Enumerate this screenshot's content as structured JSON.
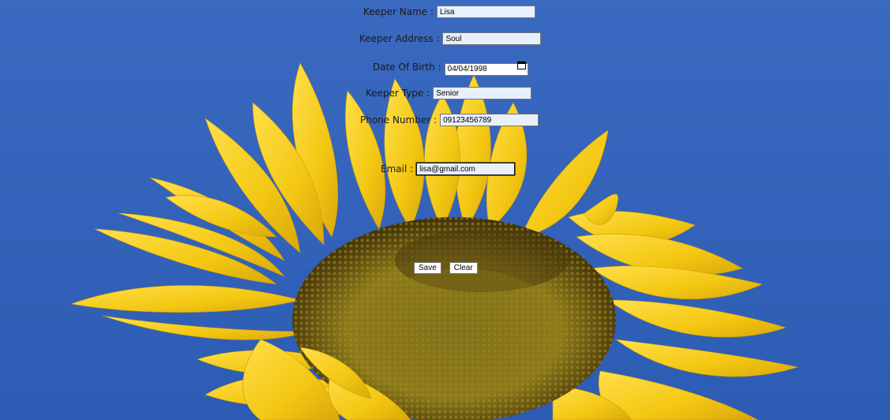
{
  "form": {
    "keeper_name": {
      "label": "Keeper Name :",
      "value": "Lisa"
    },
    "keeper_address": {
      "label": "Keeper Address :",
      "value": "Soul"
    },
    "date_of_birth": {
      "label": "Date Of Birth :",
      "value": "04/04/1998"
    },
    "keeper_type": {
      "label": "Keeper Type :",
      "value": "Senior"
    },
    "phone_number": {
      "label": "Phone Number :",
      "value": "09123456789"
    },
    "email": {
      "label": "Email :",
      "value": "lisa@gmail.com"
    }
  },
  "buttons": {
    "save_label": "Save",
    "clear_label": "Clear"
  },
  "colors": {
    "sky": "#2f62b8",
    "petal": "#f2c811",
    "seed_head": "#6b5a12",
    "field_bg": "#e8f0fe"
  },
  "background": {
    "subject": "sunflower-image"
  }
}
